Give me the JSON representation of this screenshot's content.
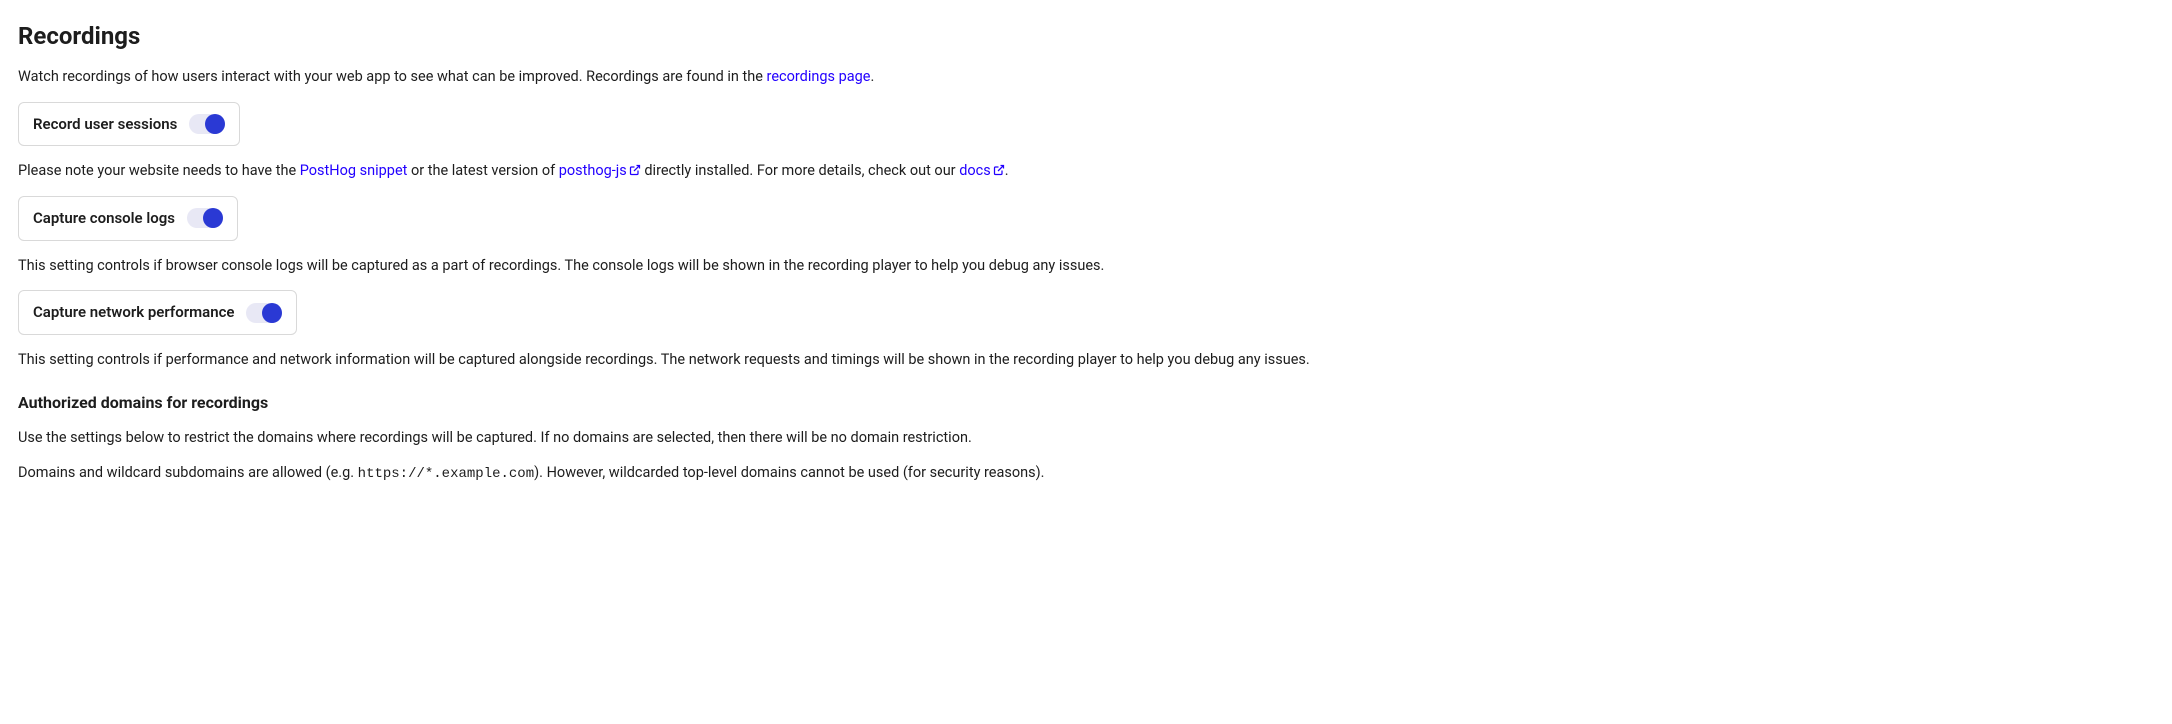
{
  "heading": "Recordings",
  "intro": {
    "text1": "Watch recordings of how users interact with your web app to see what can be improved. Recordings are found in the ",
    "link": "recordings page",
    "text2": "."
  },
  "toggles": {
    "record_sessions": {
      "label": "Record user sessions",
      "on": true
    },
    "console_logs": {
      "label": "Capture console logs",
      "on": true
    },
    "network_perf": {
      "label": "Capture network performance",
      "on": true
    }
  },
  "snippet_note": {
    "t1": "Please note your website needs to have the ",
    "link1": "PostHog snippet",
    "t2": " or the latest version of ",
    "link2": "posthog-js",
    "t3": " directly installed. For more details, check out our ",
    "link3": "docs",
    "t4": "."
  },
  "console_desc": "This setting controls if browser console logs will be captured as a part of recordings. The console logs will be shown in the recording player to help you debug any issues.",
  "network_desc": "This setting controls if performance and network information will be captured alongside recordings. The network requests and timings will be shown in the recording player to help you debug any issues.",
  "domains": {
    "heading": "Authorized domains for recordings",
    "p1": "Use the settings below to restrict the domains where recordings will be captured. If no domains are selected, then there will be no domain restriction.",
    "p2a": "Domains and wildcard subdomains are allowed (e.g. ",
    "code": "https://*.example.com",
    "p2b": "). However, wildcarded top-level domains cannot be used (for security reasons)."
  }
}
